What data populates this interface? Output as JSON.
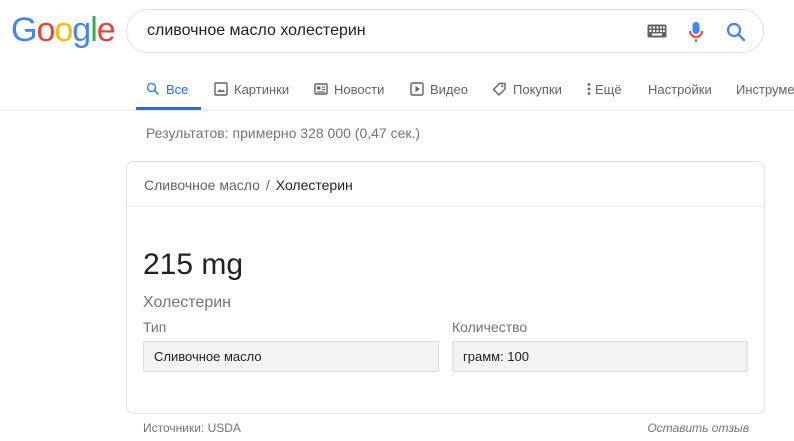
{
  "logo": {
    "letters": [
      {
        "char": "G",
        "color": "#4285F4"
      },
      {
        "char": "o",
        "color": "#EA4335"
      },
      {
        "char": "o",
        "color": "#FBBC05"
      },
      {
        "char": "g",
        "color": "#4285F4"
      },
      {
        "char": "l",
        "color": "#34A853"
      },
      {
        "char": "e",
        "color": "#EA4335"
      }
    ]
  },
  "search": {
    "query": "сливочное масло холестерин",
    "keyboard_icon": "keyboard-icon",
    "mic_icon": "microphone-icon",
    "search_icon": "search-icon"
  },
  "tabs": [
    {
      "label": "Все",
      "icon": "search-icon",
      "active": true
    },
    {
      "label": "Картинки",
      "icon": "image-icon"
    },
    {
      "label": "Новости",
      "icon": "news-icon"
    },
    {
      "label": "Видео",
      "icon": "video-icon"
    },
    {
      "label": "Покупки",
      "icon": "tag-icon"
    },
    {
      "label": "Ещё",
      "icon": "more-vert-icon"
    },
    {
      "label": "Настройки"
    },
    {
      "label": "Инструменты"
    }
  ],
  "results_count": "Результатов: примерно 328 000 (0,47 сек.)",
  "card": {
    "breadcrumb": {
      "parent": "Сливочное масло",
      "separator": "/",
      "current": "Холестерин"
    },
    "value": "215 mg",
    "nutrient": "Холестерин",
    "type_label": "Тип",
    "type_value": "Сливочное масло",
    "quantity_label": "Количество",
    "quantity_value": "грамм: 100"
  },
  "footer": {
    "source": "Источники: USDA",
    "feedback": "Оставить отзыв"
  },
  "colors": {
    "accent": "#1a73e8",
    "text_secondary": "#5f6368"
  }
}
